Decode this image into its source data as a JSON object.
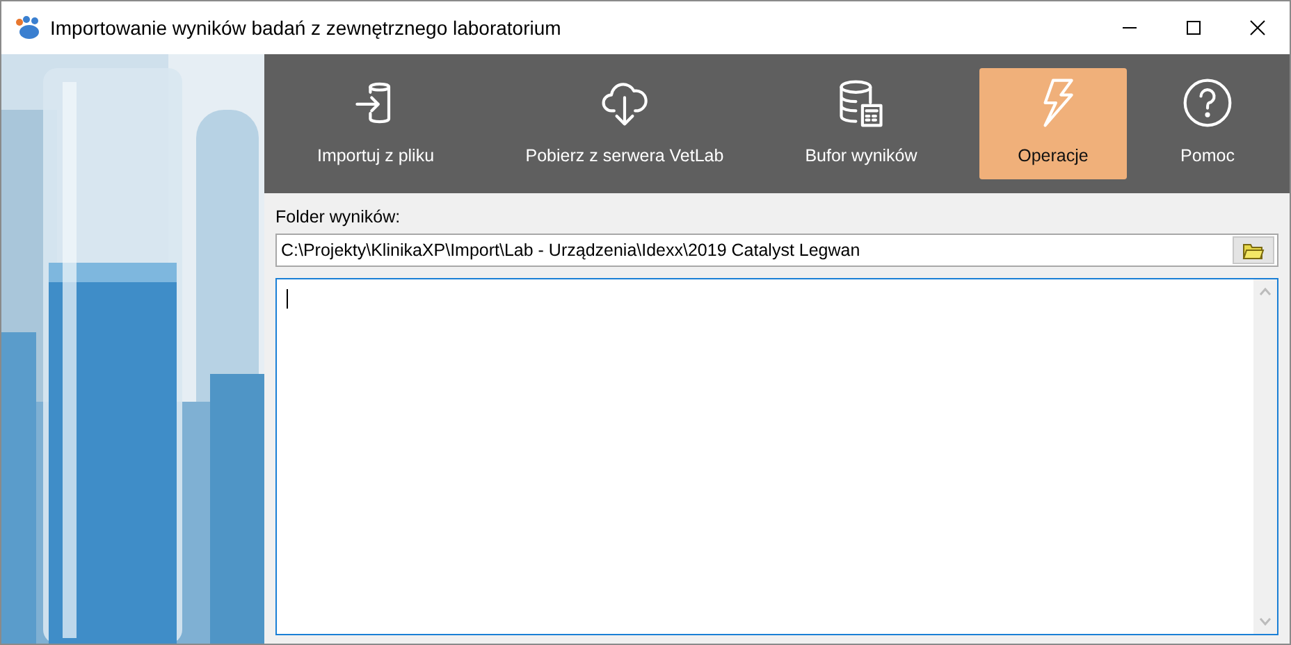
{
  "window": {
    "title": "Importowanie wyników badań z zewnętrznego laboratorium"
  },
  "toolbar": [
    {
      "label": "Importuj z pliku",
      "kind": "import",
      "selected": false
    },
    {
      "label": "Pobierz z serwera VetLab",
      "kind": "cloud",
      "selected": false
    },
    {
      "label": "Bufor wyników",
      "kind": "buffer",
      "selected": false
    },
    {
      "label": "Operacje",
      "kind": "bolt",
      "selected": true
    },
    {
      "label": "Pomoc",
      "kind": "help",
      "selected": false
    }
  ],
  "folder": {
    "label": "Folder wyników:",
    "value": "C:\\Projekty\\KlinikaXP\\Import\\Lab - Urządzenia\\Idexx\\2019 Catalyst Legwan"
  }
}
